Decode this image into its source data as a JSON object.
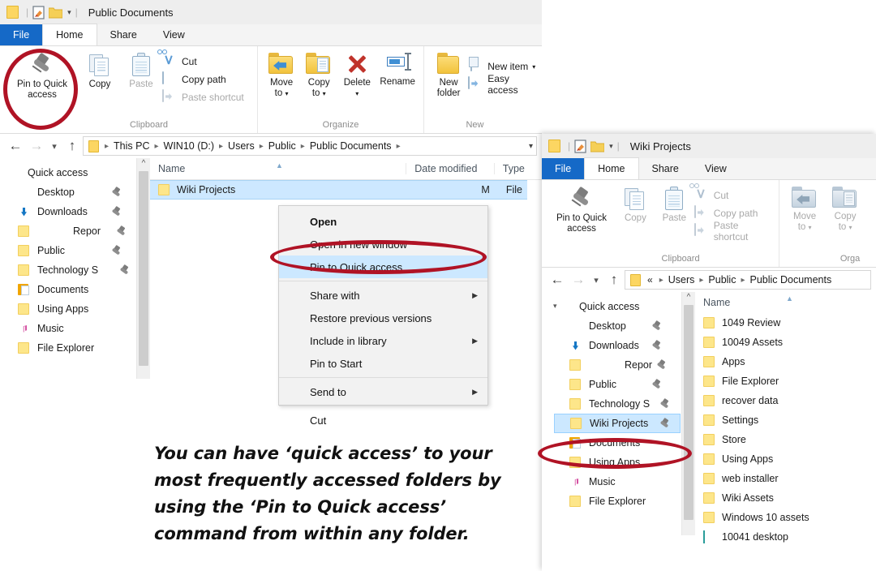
{
  "back_window": {
    "title": "Public Documents",
    "titlebar_icons": [
      "folder-icon",
      "properties-icon",
      "new-folder-icon",
      "chevron-down-icon"
    ],
    "tabs": [
      {
        "label": "File",
        "state": "file"
      },
      {
        "label": "Home",
        "state": "active"
      },
      {
        "label": "Share",
        "state": "normal"
      },
      {
        "label": "View",
        "state": "normal"
      }
    ],
    "ribbon": {
      "clipboard": {
        "group_label": "Clipboard",
        "pin": "Pin to Quick\naccess",
        "pin_line1": "Pin to Quick",
        "pin_line2": "access",
        "copy": "Copy",
        "paste": "Paste",
        "cut": "Cut",
        "copy_path": "Copy path",
        "paste_shortcut": "Paste shortcut"
      },
      "organize": {
        "group_label": "Organize",
        "move_to_l1": "Move",
        "move_to_l2": "to",
        "copy_to_l1": "Copy",
        "copy_to_l2": "to",
        "delete": "Delete",
        "rename": "Rename"
      },
      "new": {
        "group_label": "New",
        "new_folder_l1": "New",
        "new_folder_l2": "folder",
        "new_item": "New item",
        "easy_access": "Easy access"
      }
    },
    "address": {
      "crumbs": [
        "This PC",
        "WIN10 (D:)",
        "Users",
        "Public",
        "Public Documents"
      ]
    },
    "nav_pane": [
      {
        "label": "Quick access",
        "icon": "lightning-icon",
        "pinned": false
      },
      {
        "label": "Desktop",
        "icon": "desktop-icon",
        "pinned": true
      },
      {
        "label": "Downloads",
        "icon": "downloads-icon",
        "pinned": true
      },
      {
        "label": "Repor",
        "icon": "folder-icon",
        "pinned": true,
        "indent": true
      },
      {
        "label": "Public",
        "icon": "folder-icon",
        "pinned": true
      },
      {
        "label": "Technology S",
        "icon": "folder-icon",
        "pinned": true
      },
      {
        "label": "Documents",
        "icon": "documents-icon",
        "pinned": false
      },
      {
        "label": "Using Apps",
        "icon": "folder-icon",
        "pinned": false
      },
      {
        "label": "Music",
        "icon": "music-icon",
        "pinned": false
      },
      {
        "label": "File Explorer",
        "icon": "folder-icon",
        "pinned": false
      }
    ],
    "columns": [
      {
        "label": "Name"
      },
      {
        "label": "Date modified"
      },
      {
        "label": "Type"
      }
    ],
    "rows": [
      {
        "name": "Wiki Projects",
        "date_fragment": "M",
        "type_fragment": "File",
        "icon": "folder-icon",
        "selected": true
      }
    ]
  },
  "context_menu": {
    "items": [
      {
        "label": "Open",
        "bold": true,
        "submenu": false,
        "highlighted": false
      },
      {
        "label": "Open in new window",
        "bold": false,
        "submenu": false,
        "highlighted": false
      },
      {
        "label": "Pin to Quick access",
        "bold": false,
        "submenu": false,
        "highlighted": true
      },
      {
        "separator": true
      },
      {
        "label": "Share with",
        "bold": false,
        "submenu": true,
        "highlighted": false
      },
      {
        "label": "Restore previous versions",
        "bold": false,
        "submenu": false,
        "highlighted": false
      },
      {
        "label": "Include in library",
        "bold": false,
        "submenu": true,
        "highlighted": false
      },
      {
        "label": "Pin to Start",
        "bold": false,
        "submenu": false,
        "highlighted": false
      },
      {
        "separator": true
      },
      {
        "label": "Send to",
        "bold": false,
        "submenu": true,
        "highlighted": false
      },
      {
        "separator": true
      },
      {
        "label": "Cut",
        "bold": false,
        "submenu": false,
        "highlighted": false
      }
    ]
  },
  "front_window": {
    "title": "Wiki Projects",
    "tabs": [
      {
        "label": "File",
        "state": "file"
      },
      {
        "label": "Home",
        "state": "active"
      },
      {
        "label": "Share",
        "state": "normal"
      },
      {
        "label": "View",
        "state": "normal"
      }
    ],
    "ribbon": {
      "clipboard": {
        "group_label": "Clipboard",
        "pin_line1": "Pin to Quick",
        "pin_line2": "access",
        "copy": "Copy",
        "paste": "Paste",
        "cut": "Cut",
        "copy_path": "Copy path",
        "paste_shortcut": "Paste shortcut"
      },
      "organize": {
        "group_label": "Orga",
        "move_to_l1": "Move",
        "move_to_l2": "to",
        "copy_to_l1": "Copy",
        "copy_to_l2": "to"
      }
    },
    "address": {
      "overflow": "«",
      "crumbs": [
        "Users",
        "Public",
        "Public Documents"
      ]
    },
    "nav_pane": [
      {
        "label": "Quick access",
        "icon": "lightning-icon",
        "pinned": false,
        "expander": "∨"
      },
      {
        "label": "Desktop",
        "icon": "desktop-icon",
        "pinned": true
      },
      {
        "label": "Downloads",
        "icon": "downloads-icon",
        "pinned": true
      },
      {
        "label": "Repor",
        "icon": "folder-icon",
        "pinned": true,
        "indent": true
      },
      {
        "label": "Public",
        "icon": "folder-icon",
        "pinned": true
      },
      {
        "label": "Technology S",
        "icon": "folder-icon",
        "pinned": true
      },
      {
        "label": "Wiki Projects",
        "icon": "folder-icon",
        "pinned": true,
        "selected": true
      },
      {
        "label": "Documents",
        "icon": "documents-icon",
        "pinned": false
      },
      {
        "label": "Using Apps",
        "icon": "folder-icon",
        "pinned": false
      },
      {
        "label": "Music",
        "icon": "music-icon",
        "pinned": false
      },
      {
        "label": "File Explorer",
        "icon": "folder-icon",
        "pinned": false
      }
    ],
    "columns": [
      {
        "label": "Name"
      }
    ],
    "rows": [
      {
        "name": "1049 Review",
        "icon": "folder-icon"
      },
      {
        "name": "10049 Assets",
        "icon": "folder-icon"
      },
      {
        "name": "Apps",
        "icon": "folder-icon"
      },
      {
        "name": "File Explorer",
        "icon": "folder-icon"
      },
      {
        "name": "recover data",
        "icon": "folder-icon"
      },
      {
        "name": "Settings",
        "icon": "folder-icon"
      },
      {
        "name": "Store",
        "icon": "folder-icon"
      },
      {
        "name": "Using Apps",
        "icon": "folder-icon"
      },
      {
        "name": "web installer",
        "icon": "folder-icon"
      },
      {
        "name": "Wiki Assets",
        "icon": "folder-icon"
      },
      {
        "name": "Windows 10 assets",
        "icon": "folder-icon"
      },
      {
        "name": "10041 desktop",
        "icon": "picture-icon"
      }
    ]
  },
  "annotation": {
    "color": "#b01325",
    "caption_lines": [
      "You can have ‘quick access’ to your",
      "most frequently accessed folders by",
      "using the ‘Pin to Quick access’",
      "command from within any folder."
    ]
  }
}
